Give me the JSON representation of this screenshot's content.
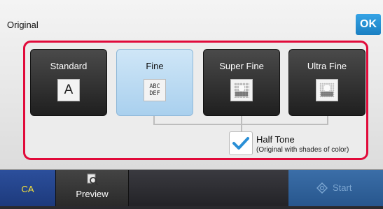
{
  "header": {
    "title": "Original",
    "ok_label": "OK"
  },
  "resolution_options": [
    {
      "label": "Standard",
      "icon_text": "A",
      "selected": false
    },
    {
      "label": "Fine",
      "icon_text": "ABC\nDEF",
      "selected": true
    },
    {
      "label": "Super Fine",
      "selected": false
    },
    {
      "label": "Ultra Fine",
      "selected": false
    }
  ],
  "half_tone": {
    "label": "Half Tone",
    "sublabel": "(Original with shades of color)",
    "checked": true
  },
  "bottom_bar": {
    "ca_label": "CA",
    "preview_label": "Preview",
    "start_label": "Start"
  },
  "colors": {
    "highlight_frame": "#e10a3a",
    "ok_button": "#1a7fc2",
    "selected_option": "#a9d0ee",
    "checkmark": "#2a8fd6",
    "ca_text": "#f6e13a"
  }
}
